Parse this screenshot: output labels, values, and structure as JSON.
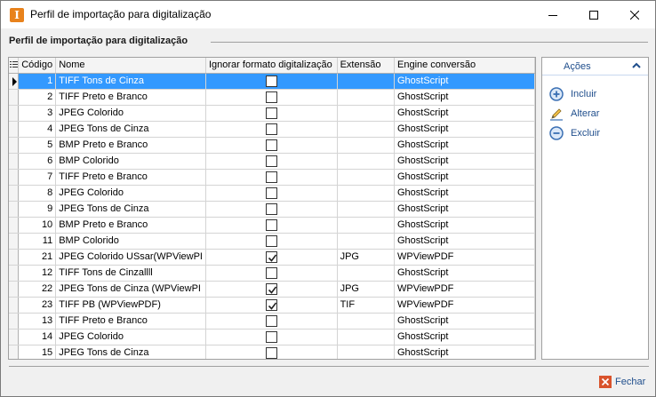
{
  "window": {
    "title": "Perfil de importação para digitalização",
    "app_icon_letter": "I"
  },
  "section": {
    "title": "Perfil de importação para digitalização"
  },
  "grid": {
    "columns": [
      "Código",
      "Nome",
      "Ignorar formato digitalização",
      "Extensão",
      "Engine conversão"
    ],
    "selected_row": 0,
    "rows": [
      {
        "code": "1",
        "name": "TIFF Tons de Cinza",
        "ignore": false,
        "ext": "",
        "engine": "GhostScript"
      },
      {
        "code": "2",
        "name": "TIFF Preto e Branco",
        "ignore": false,
        "ext": "",
        "engine": "GhostScript"
      },
      {
        "code": "3",
        "name": "JPEG Colorido",
        "ignore": false,
        "ext": "",
        "engine": "GhostScript"
      },
      {
        "code": "4",
        "name": "JPEG Tons de Cinza",
        "ignore": false,
        "ext": "",
        "engine": "GhostScript"
      },
      {
        "code": "5",
        "name": "BMP Preto e Branco",
        "ignore": false,
        "ext": "",
        "engine": "GhostScript"
      },
      {
        "code": "6",
        "name": "BMP Colorido",
        "ignore": false,
        "ext": "",
        "engine": "GhostScript"
      },
      {
        "code": "7",
        "name": "TIFF Preto e Branco",
        "ignore": false,
        "ext": "",
        "engine": "GhostScript"
      },
      {
        "code": "8",
        "name": "JPEG Colorido",
        "ignore": false,
        "ext": "",
        "engine": "GhostScript"
      },
      {
        "code": "9",
        "name": "JPEG Tons de Cinza",
        "ignore": false,
        "ext": "",
        "engine": "GhostScript"
      },
      {
        "code": "10",
        "name": "BMP Preto e Branco",
        "ignore": false,
        "ext": "",
        "engine": "GhostScript"
      },
      {
        "code": "11",
        "name": "BMP Colorido",
        "ignore": false,
        "ext": "",
        "engine": "GhostScript"
      },
      {
        "code": "21",
        "name": "JPEG Colorido USsar(WPViewPI",
        "ignore": true,
        "ext": "JPG",
        "engine": "WPViewPDF"
      },
      {
        "code": "12",
        "name": "TIFF Tons de Cinzallll",
        "ignore": false,
        "ext": "",
        "engine": "GhostScript"
      },
      {
        "code": "22",
        "name": "JPEG Tons de Cinza (WPViewPI",
        "ignore": true,
        "ext": "JPG",
        "engine": "WPViewPDF"
      },
      {
        "code": "23",
        "name": "TIFF PB (WPViewPDF)",
        "ignore": true,
        "ext": "TIF",
        "engine": "WPViewPDF"
      },
      {
        "code": "13",
        "name": "TIFF Preto e Branco",
        "ignore": false,
        "ext": "",
        "engine": "GhostScript"
      },
      {
        "code": "14",
        "name": "JPEG Colorido",
        "ignore": false,
        "ext": "",
        "engine": "GhostScript"
      },
      {
        "code": "15",
        "name": "JPEG Tons de Cinza",
        "ignore": false,
        "ext": "",
        "engine": "GhostScript"
      }
    ]
  },
  "actions": {
    "title": "Ações",
    "items": [
      {
        "label": "Incluir",
        "icon": "plus-circle-icon"
      },
      {
        "label": "Alterar",
        "icon": "pencil-icon"
      },
      {
        "label": "Excluir",
        "icon": "minus-circle-icon"
      }
    ]
  },
  "footer": {
    "close_label": "Fechar"
  },
  "colors": {
    "selection": "#3399ff",
    "accent": "#1f4e8c",
    "app_icon": "#e8821c",
    "close_icon": "#d9532c"
  }
}
